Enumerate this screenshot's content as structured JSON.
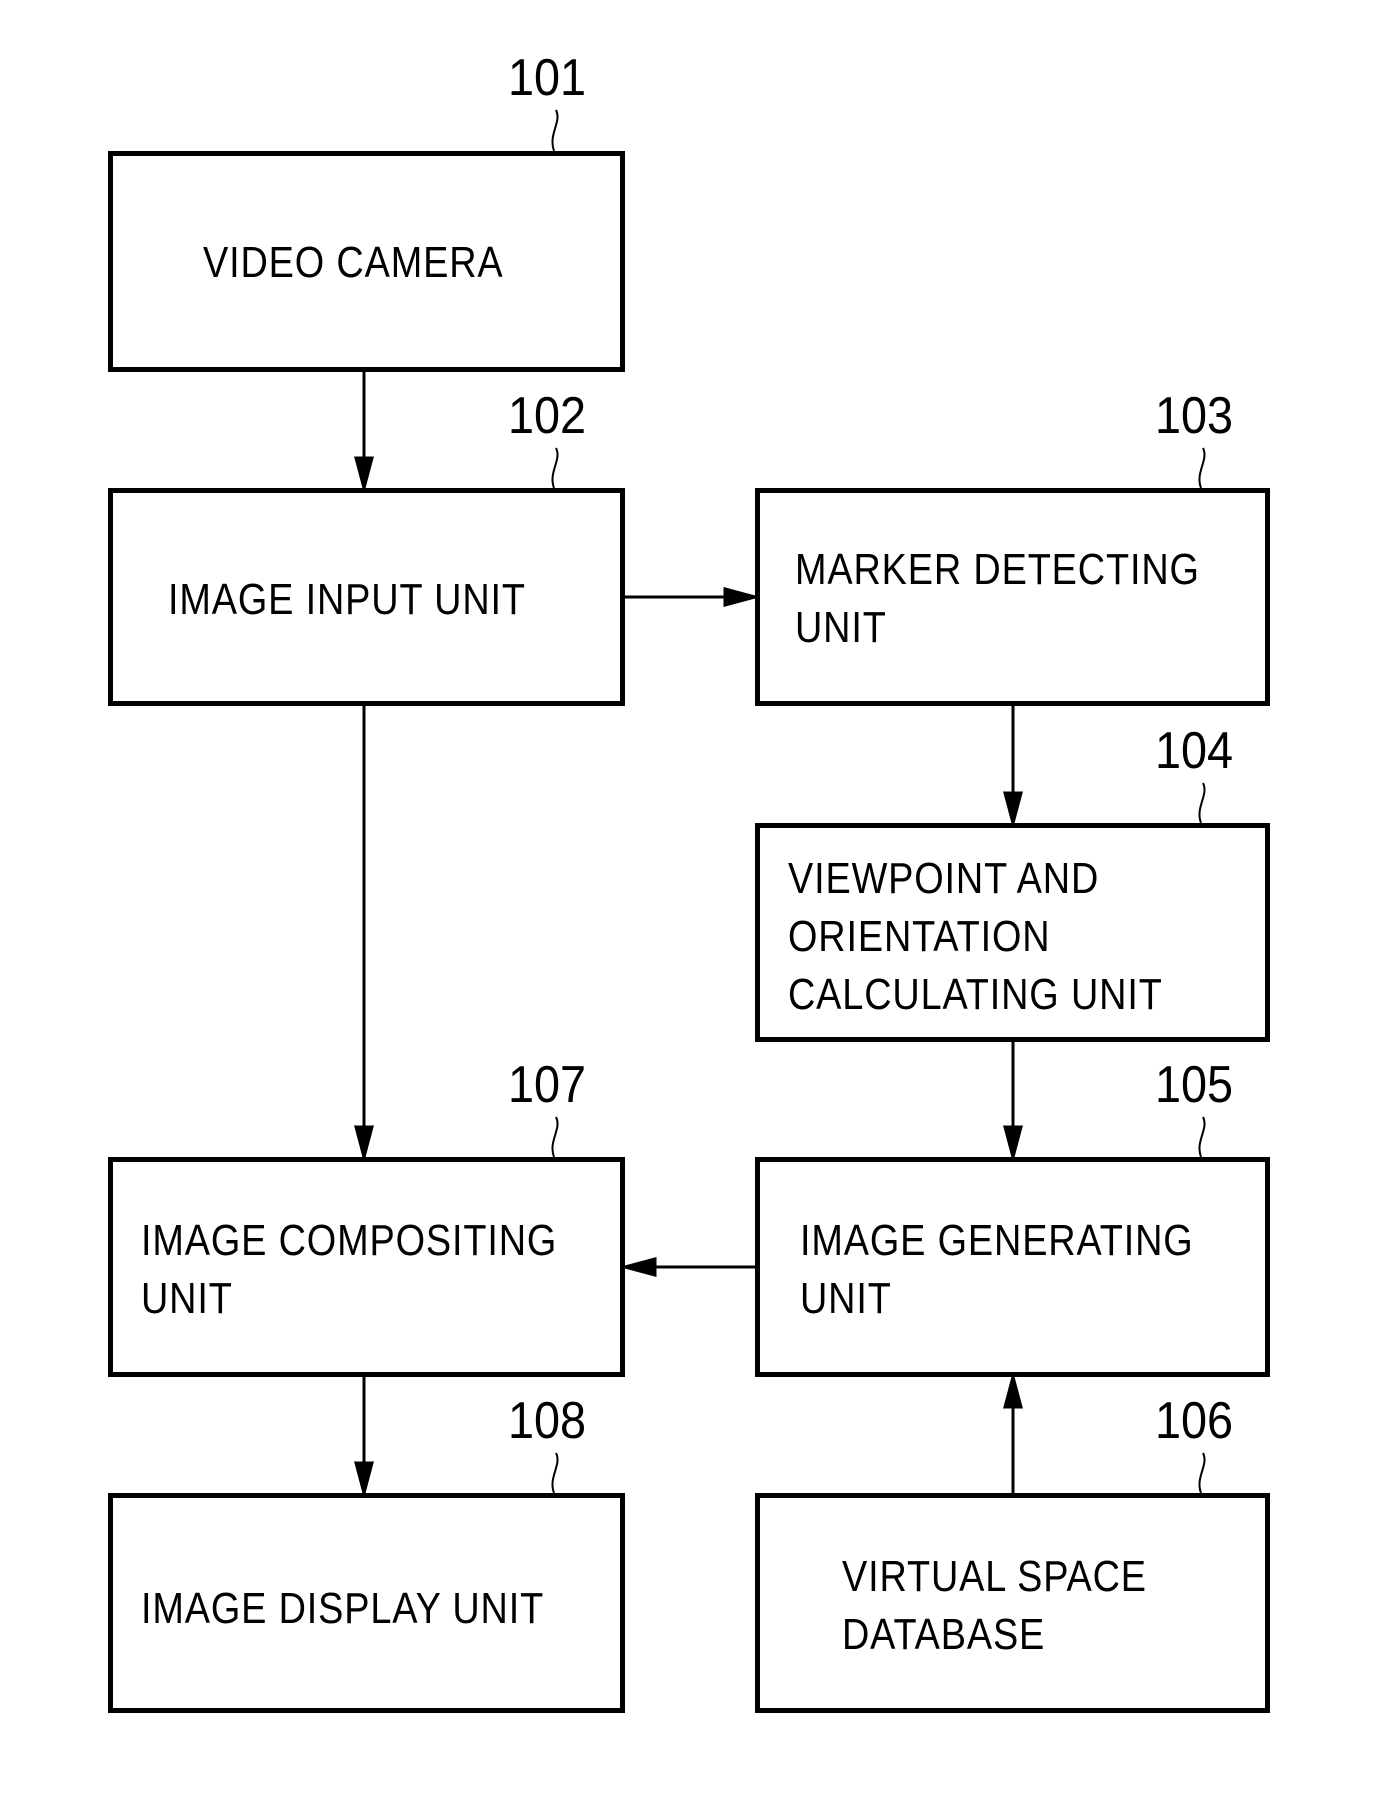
{
  "diagram": {
    "blocks": [
      {
        "id": "101",
        "label": "VIDEO CAMERA",
        "lines": [
          "VIDEO  CAMERA"
        ]
      },
      {
        "id": "102",
        "label": "IMAGE INPUT UNIT",
        "lines": [
          "IMAGE  INPUT  UNIT"
        ]
      },
      {
        "id": "103",
        "label": "MARKER DETECTING UNIT",
        "lines": [
          "MARKER  DETECTING",
          "UNIT"
        ]
      },
      {
        "id": "104",
        "label": "VIEWPOINT AND ORIENTATION CALCULATING UNIT",
        "lines": [
          "VIEWPOINT  AND",
          "ORIENTATION",
          "CALCULATING  UNIT"
        ]
      },
      {
        "id": "105",
        "label": "IMAGE GENERATING UNIT",
        "lines": [
          "IMAGE  GENERATING",
          "UNIT"
        ]
      },
      {
        "id": "106",
        "label": "VIRTUAL SPACE DATABASE",
        "lines": [
          "VIRTUAL  SPACE",
          "DATABASE"
        ]
      },
      {
        "id": "107",
        "label": "IMAGE COMPOSITING UNIT",
        "lines": [
          "IMAGE  COMPOSITING",
          "UNIT"
        ]
      },
      {
        "id": "108",
        "label": "IMAGE DISPLAY UNIT",
        "lines": [
          "IMAGE  DISPLAY  UNIT"
        ]
      }
    ],
    "arrows": [
      {
        "from": "101",
        "to": "102"
      },
      {
        "from": "102",
        "to": "103"
      },
      {
        "from": "102",
        "to": "107"
      },
      {
        "from": "103",
        "to": "104"
      },
      {
        "from": "104",
        "to": "105"
      },
      {
        "from": "105",
        "to": "107"
      },
      {
        "from": "106",
        "to": "105"
      },
      {
        "from": "107",
        "to": "108"
      }
    ]
  }
}
